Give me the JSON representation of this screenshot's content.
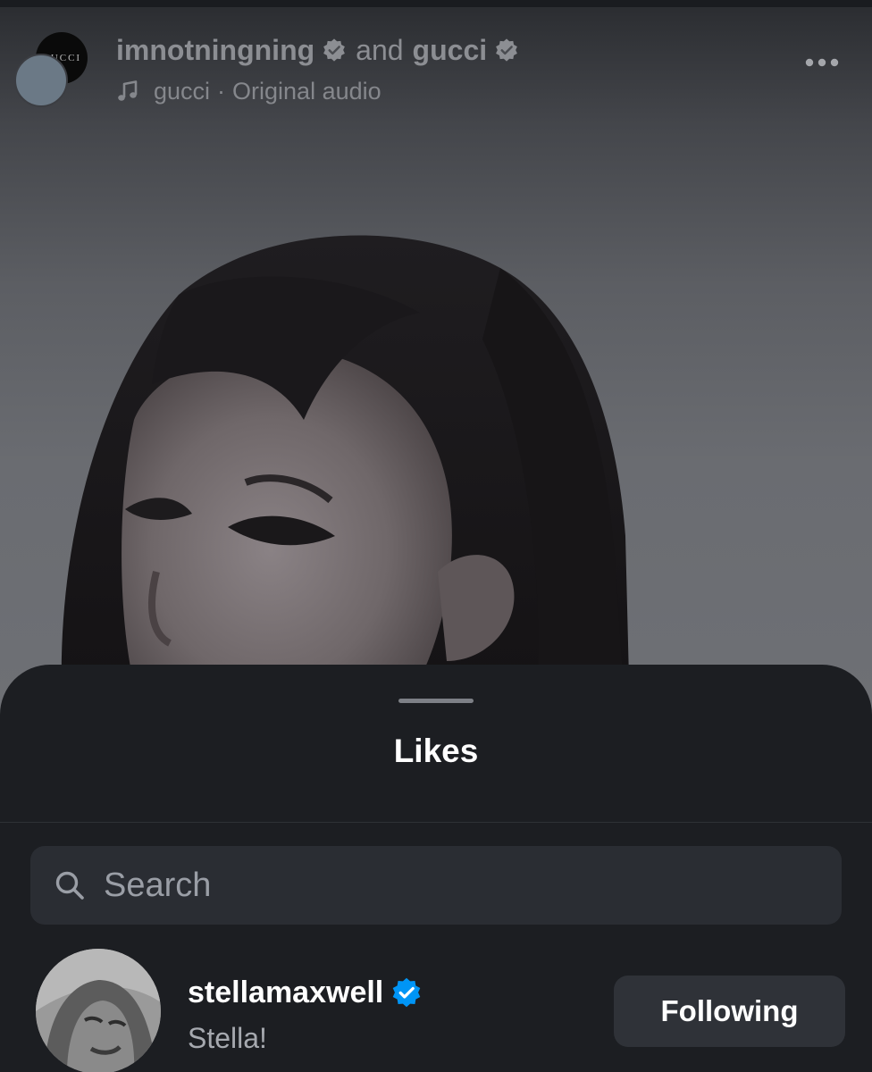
{
  "reel": {
    "author_primary": "imnotningning",
    "joiner": "and",
    "author_collab": "gucci",
    "audio_owner": "gucci",
    "audio_separator": "·",
    "audio_title": "Original audio",
    "collab_avatar_text": "GUCCI",
    "icons": {
      "music": "music-note-icon",
      "more": "more-horizontal-icon",
      "verified": "verified-badge-icon"
    }
  },
  "sheet": {
    "title": "Likes",
    "search": {
      "placeholder": "Search",
      "value": ""
    },
    "users": [
      {
        "username": "stellamaxwell",
        "full_name": "Stella!",
        "verified": true,
        "button_label": "Following"
      }
    ]
  },
  "colors": {
    "sheet_background": "#1c1e22",
    "search_background": "#2a2d33",
    "button_background": "#2f3238",
    "verified_blue": "#0095f6",
    "header_text": "#8c8e93"
  }
}
